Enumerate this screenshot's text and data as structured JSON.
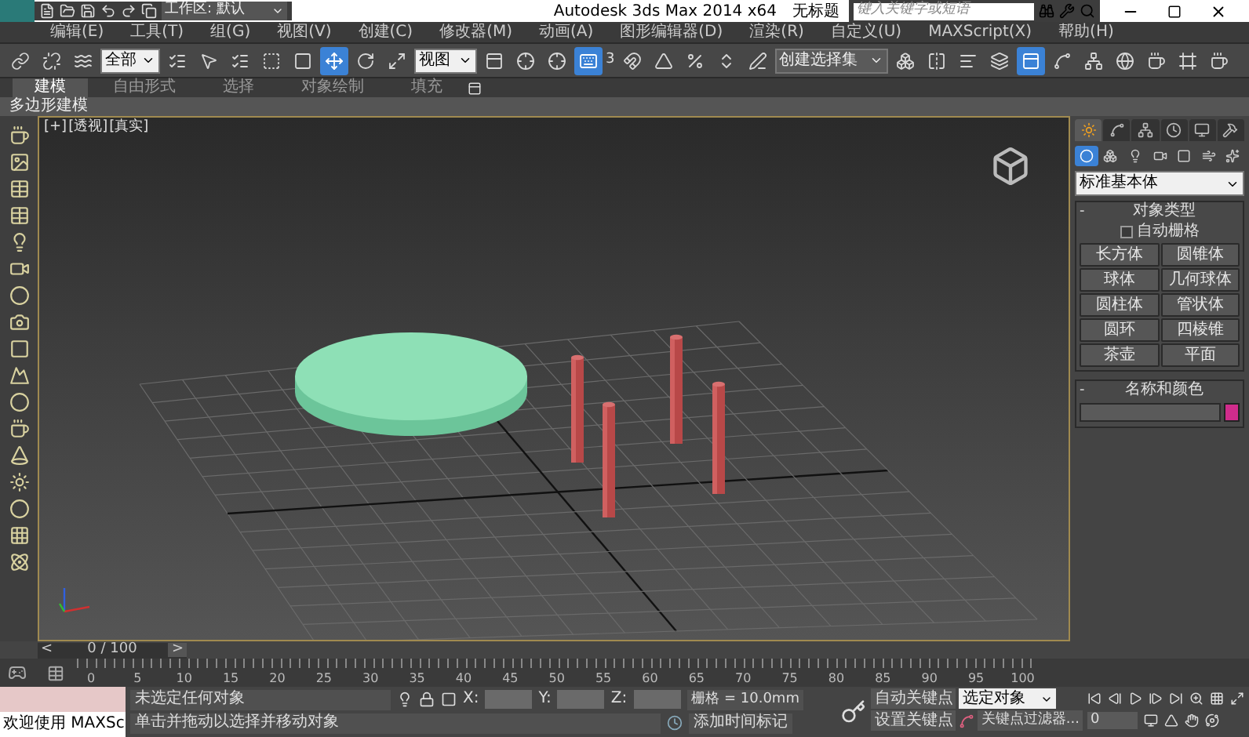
{
  "title_bar": {
    "workspace": "工作区: 默认",
    "title": "Autodesk 3ds Max  2014 x64",
    "document": "无标题",
    "search": {
      "placeholder": "键入关键字或短语"
    }
  },
  "menu": [
    "编辑(E)",
    "工具(T)",
    "组(G)",
    "视图(V)",
    "创建(C)",
    "修改器(M)",
    "动画(A)",
    "图形编辑器(D)",
    "渲染(R)",
    "自定义(U)",
    "MAXScript(X)",
    "帮助(H)"
  ],
  "toolbar": {
    "selection_filter": "全部",
    "reference_coord": "视图",
    "snap_label": "3",
    "selection_set": "创建选择集",
    "tools": [
      {
        "kind": "link",
        "selected": false
      },
      {
        "kind": "unlink",
        "selected": false
      },
      {
        "kind": "bind",
        "selected": false
      },
      {
        "kind": "filter",
        "selected": false
      },
      {
        "kind": "select",
        "selected": false
      },
      {
        "kind": "select-name",
        "selected": false
      },
      {
        "kind": "region",
        "selected": false
      },
      {
        "kind": "window",
        "selected": false
      },
      {
        "kind": "move",
        "selected": true
      },
      {
        "kind": "rotate",
        "selected": false
      },
      {
        "kind": "scale",
        "selected": false
      },
      {
        "kind": "coord",
        "selected": false
      },
      {
        "kind": "pivot",
        "selected": false
      },
      {
        "kind": "manipulate",
        "selected": false
      },
      {
        "kind": "keyboard",
        "selected": true
      },
      {
        "kind": "snap",
        "selected": false
      },
      {
        "kind": "angle",
        "selected": false
      },
      {
        "kind": "percent",
        "selected": false
      },
      {
        "kind": "spinner",
        "selected": false
      },
      {
        "kind": "edit-set",
        "selected": false
      },
      {
        "kind": "set",
        "selected": false
      },
      {
        "kind": "mirror",
        "selected": false
      },
      {
        "kind": "align",
        "selected": false
      },
      {
        "kind": "layers",
        "selected": false
      },
      {
        "kind": "explorer",
        "selected": true
      },
      {
        "kind": "curve",
        "selected": false
      },
      {
        "kind": "schematic",
        "selected": false
      },
      {
        "kind": "material",
        "selected": false
      },
      {
        "kind": "render-setup",
        "selected": false
      },
      {
        "kind": "frame",
        "selected": false
      },
      {
        "kind": "render",
        "selected": false
      }
    ]
  },
  "ribbon": {
    "tabs": [
      {
        "label": "建模",
        "selected": true
      },
      {
        "label": "自由形式",
        "selected": false
      },
      {
        "label": "选择",
        "selected": false
      },
      {
        "label": "对象绘制",
        "selected": false
      },
      {
        "label": "填充",
        "selected": false
      }
    ],
    "panel": "多边形建模"
  },
  "viewport": {
    "labels": [
      "[+]",
      "[透视]",
      "[真实]"
    ]
  },
  "command_panel": {
    "tabs": [
      {
        "selected": true
      },
      {
        "selected": false
      },
      {
        "selected": false
      },
      {
        "selected": false
      },
      {
        "selected": false
      },
      {
        "selected": false
      }
    ],
    "categories": [
      {
        "selected": true
      },
      {
        "selected": false
      },
      {
        "selected": false
      },
      {
        "selected": false
      },
      {
        "selected": false
      },
      {
        "selected": false
      },
      {
        "selected": false
      }
    ],
    "dropdown": "标准基本体",
    "object_type": {
      "toggle": "-",
      "title": "对象类型",
      "auto_grid": {
        "label": "自动栅格",
        "checked": false
      },
      "buttons": [
        "长方体",
        "圆锥体",
        "球体",
        "几何球体",
        "圆柱体",
        "管状体",
        "圆环",
        "四棱锥",
        "茶壶",
        "平面"
      ]
    },
    "name_color": {
      "toggle": "-",
      "title": "名称和颜色",
      "color": "#d02c8c"
    }
  },
  "timeline": {
    "prev": "<",
    "frame": "0 / 100",
    "next": ">",
    "ticks": [
      "0",
      "5",
      "10",
      "15",
      "20",
      "25",
      "30",
      "35",
      "40",
      "45",
      "50",
      "55",
      "60",
      "65",
      "70",
      "75",
      "80",
      "85",
      "90",
      "95",
      "100"
    ]
  },
  "status": {
    "maxscript": "欢迎使用 MAXSc",
    "selection": "未选定任何对象",
    "prompt": "单击并拖动以选择并移动对象",
    "x_label": "X:",
    "y_label": "Y:",
    "z_label": "Z:",
    "grid": "栅格 = 10.0mm",
    "add_time_tag": "添加时间标记",
    "auto_key": "自动关键点",
    "set_key": "设置关键点",
    "key_mode": "选定对象",
    "key_filters": "关键点过滤器...",
    "current_frame": "0"
  }
}
